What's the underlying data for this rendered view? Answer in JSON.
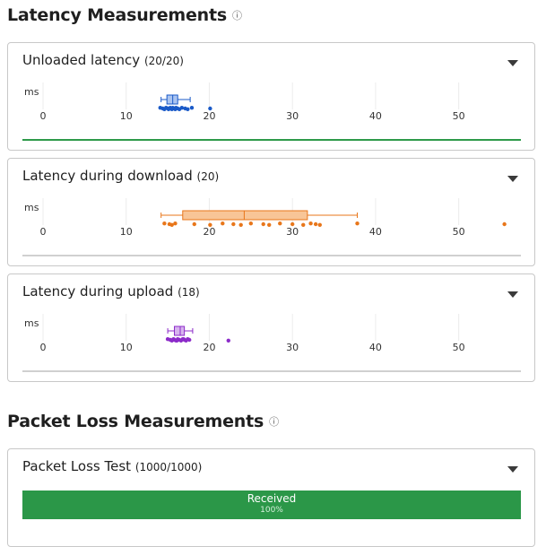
{
  "latency": {
    "title": "Latency Measurements",
    "info_icon": "ⓘ",
    "unit": "ms",
    "ticks": [
      0,
      10,
      20,
      30,
      40,
      50
    ],
    "axis_range": [
      0,
      55
    ],
    "panels": [
      {
        "key": "unloaded",
        "title": "Unloaded latency",
        "count": "(20/20)",
        "color": "#1a5ac8",
        "fill": "#aac4f0",
        "footer_color": "#2e9a4a",
        "box": {
          "min": 14.2,
          "q1": 14.9,
          "median": 15.6,
          "q3": 16.2,
          "max": 17.7
        },
        "points": [
          14.1,
          14.4,
          14.6,
          14.8,
          15.0,
          15.1,
          15.3,
          15.4,
          15.5,
          15.6,
          15.8,
          15.9,
          16.0,
          16.2,
          16.4,
          16.7,
          17.1,
          17.4,
          17.9,
          20.1
        ]
      },
      {
        "key": "download",
        "title": "Latency during download",
        "count": "(20)",
        "color": "#e8761a",
        "fill": "#f8c597",
        "footer_color": "#d0d0d0",
        "box": {
          "min": 14.2,
          "q1": 16.8,
          "median": 24.2,
          "q3": 31.8,
          "max": 37.8
        },
        "points": [
          14.6,
          15.2,
          15.5,
          15.9,
          18.2,
          20.1,
          21.6,
          22.9,
          23.8,
          25.0,
          26.5,
          27.2,
          28.5,
          30.0,
          31.3,
          32.2,
          32.8,
          33.3,
          37.8,
          55.5
        ]
      },
      {
        "key": "upload",
        "title": "Latency during upload",
        "count": "(18)",
        "color": "#8c2bc9",
        "fill": "#d7b3ee",
        "footer_color": "#d0d0d0",
        "box": {
          "min": 15.0,
          "q1": 15.8,
          "median": 16.5,
          "q3": 17.0,
          "max": 18.0
        },
        "points": [
          15.0,
          15.3,
          15.5,
          15.7,
          15.8,
          16.0,
          16.2,
          16.4,
          16.6,
          16.8,
          17.0,
          17.2,
          17.4,
          15.6,
          16.1,
          16.9,
          17.6,
          22.3
        ]
      }
    ]
  },
  "packet_loss": {
    "title": "Packet Loss Measurements",
    "info_icon": "ⓘ",
    "test_title": "Packet Loss Test",
    "count": "(1000/1000)",
    "bar_label": "Received",
    "bar_pct_label": "100%",
    "received_fraction": 1.0,
    "color": "#2b9748"
  }
}
